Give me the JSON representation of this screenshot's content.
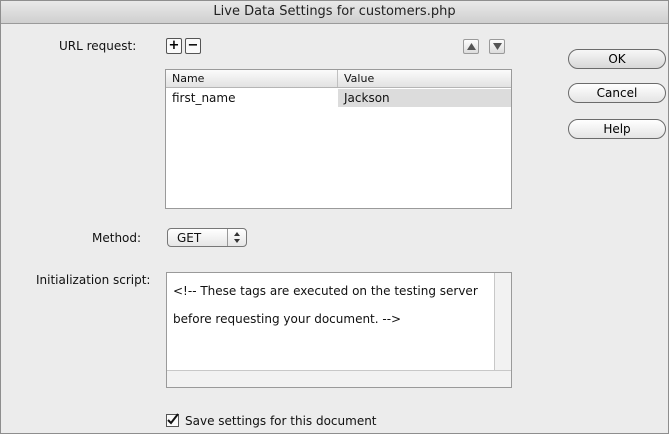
{
  "window": {
    "title": "Live Data Settings for customers.php"
  },
  "url_request": {
    "label": "URL request:",
    "add_icon": "+",
    "remove_icon": "−",
    "columns": [
      "Name",
      "Value"
    ],
    "rows": [
      {
        "name": "first_name",
        "value": "Jackson"
      }
    ]
  },
  "buttons": {
    "ok": "OK",
    "cancel": "Cancel",
    "help": "Help"
  },
  "method": {
    "label": "Method:",
    "selected": "GET"
  },
  "init_script": {
    "label": "Initialization script:",
    "line1": "<!-- These tags are executed on the testing server",
    "line2": "before requesting your document. -->"
  },
  "save_settings": {
    "checked": true,
    "label": "Save settings for this document"
  }
}
